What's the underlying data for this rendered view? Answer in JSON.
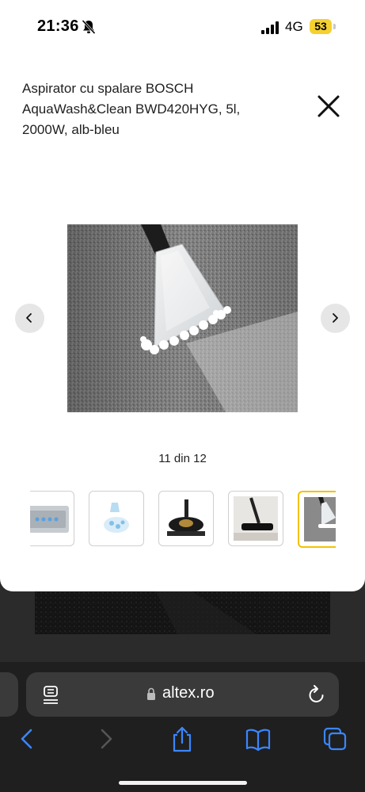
{
  "status_bar": {
    "time": "21:36",
    "network": "4G",
    "battery": "53",
    "battery_color": "#f5d130",
    "icons": [
      "bell-slash-icon",
      "signal-bars-icon",
      "battery-icon"
    ]
  },
  "modal": {
    "product_title": "Aspirator cu spalare BOSCH AquaWash&Clean BWD420HYG, 5l, 2000W, alb-bleu",
    "close_icon": "close-x-icon",
    "prev_icon": "chevron-left-icon",
    "next_icon": "chevron-right-icon",
    "image_counter": "11 din 12",
    "active_thumb_color": "#f2c200",
    "thumbnails": [
      {
        "name": "control-panel"
      },
      {
        "name": "water-tank"
      },
      {
        "name": "floor-nozzle-round"
      },
      {
        "name": "floor-nozzle"
      },
      {
        "name": "carpet-nozzle",
        "active": true
      }
    ]
  },
  "browser": {
    "url": "altex.ro",
    "icons": [
      "reader-icon",
      "lock-icon",
      "reload-icon",
      "back-icon",
      "forward-icon",
      "share-icon",
      "bookmarks-icon",
      "tabs-icon"
    ],
    "accent_color": "#3a86ff"
  }
}
